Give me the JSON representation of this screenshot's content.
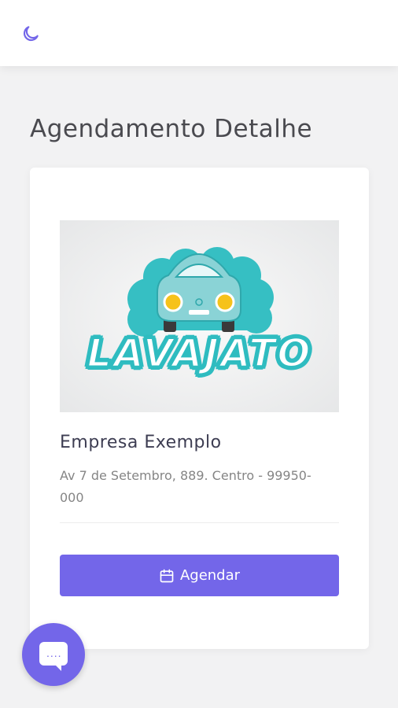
{
  "header": {
    "theme_icon": "moon-icon"
  },
  "page": {
    "title": "Agendamento Detalhe"
  },
  "card": {
    "image": {
      "logo_text": "LAVAJATO",
      "colors": {
        "car": "#8ad3d6",
        "cloud": "#36bfc3",
        "headlight": "#f6c21a"
      }
    },
    "company_name": "Empresa Exemplo",
    "address": "Av 7 de Setembro, 889. Centro - 99950-000",
    "button": {
      "label": "Agendar",
      "icon": "calendar-icon",
      "color": "#7366e9"
    }
  },
  "chat_widget": {
    "icon": "chat-icon",
    "dots": "...."
  }
}
